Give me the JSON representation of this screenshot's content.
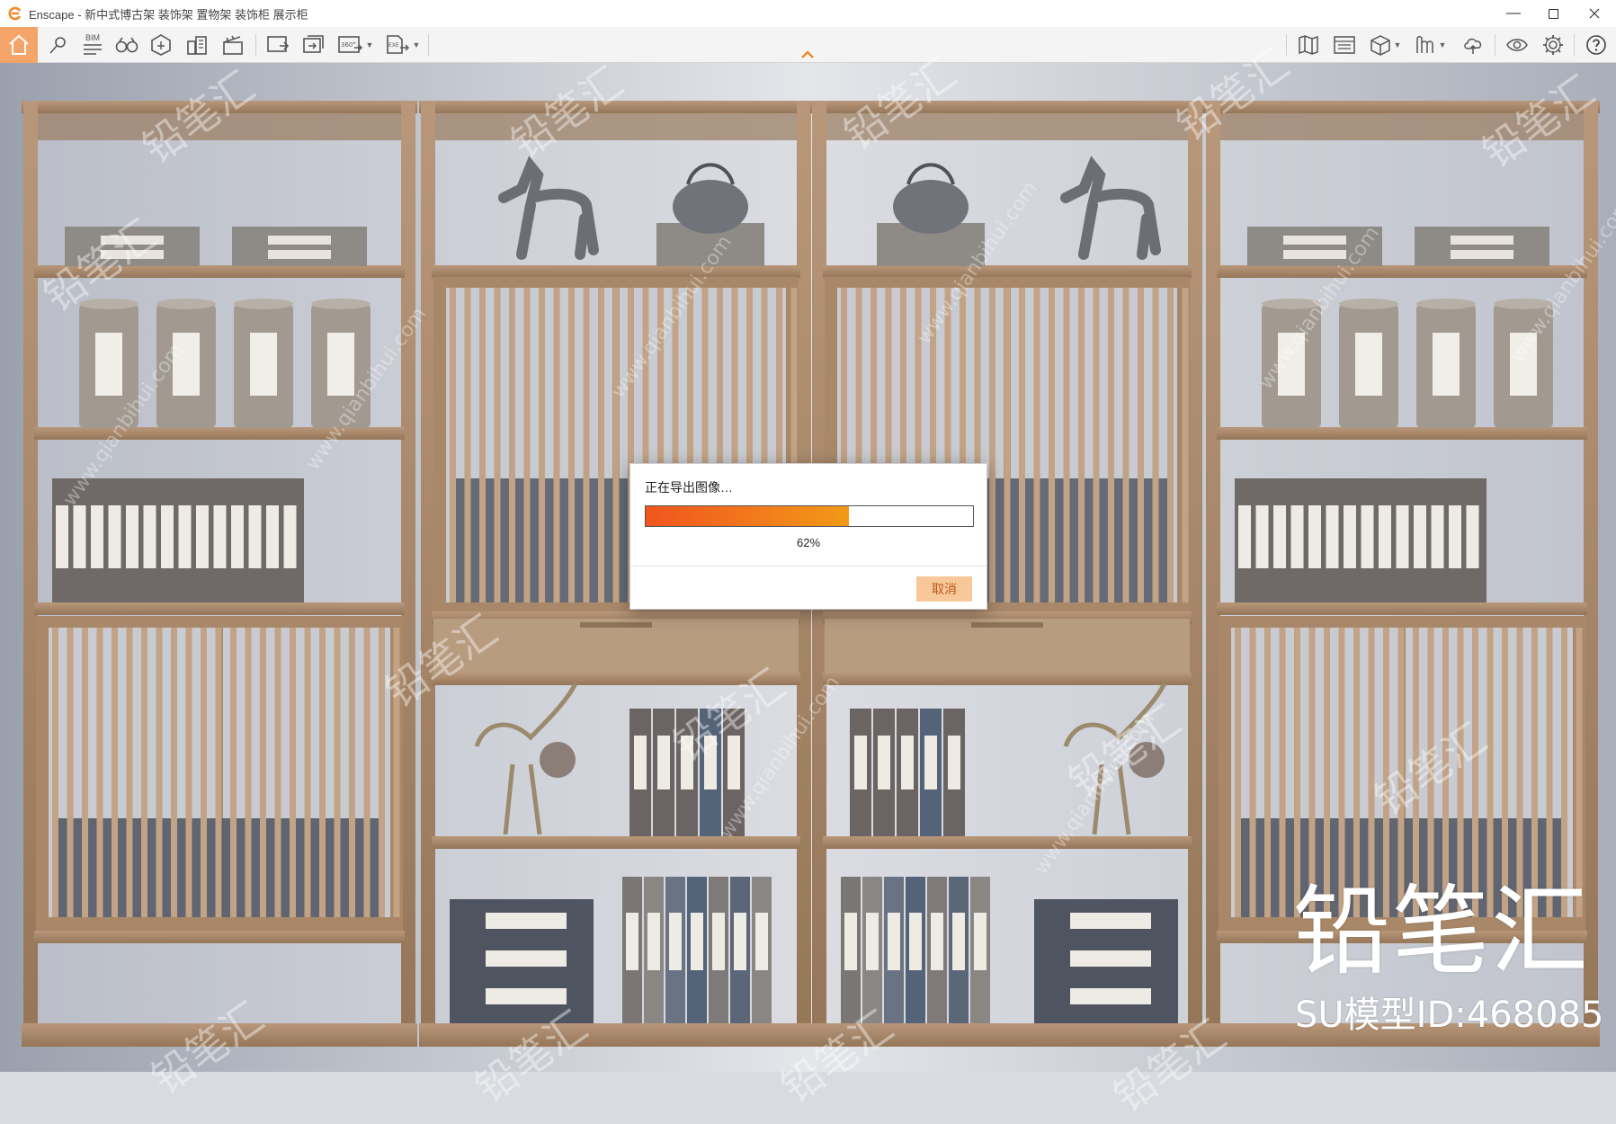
{
  "window": {
    "app_name": "Enscape",
    "title": "Enscape - 新中式博古架 装饰架 置物架 装饰柜 展示柜"
  },
  "toolbar": {
    "bim_label": "BIM",
    "panorama_label": "360°",
    "exe_label": "EXE"
  },
  "dialog": {
    "message": "正在导出图像…",
    "progress_percent": 62,
    "progress_text": "62%",
    "cancel_label": "取消"
  },
  "overlay": {
    "brand": "铅笔汇",
    "model_id": "SU模型ID:468085",
    "watermark_text": "铅笔汇",
    "watermark_url": "www.qianbihui.com"
  },
  "colors": {
    "accent": "#f5a46a",
    "progress_start": "#f0551e",
    "progress_end": "#f29a16",
    "wood": "#a8886a"
  }
}
